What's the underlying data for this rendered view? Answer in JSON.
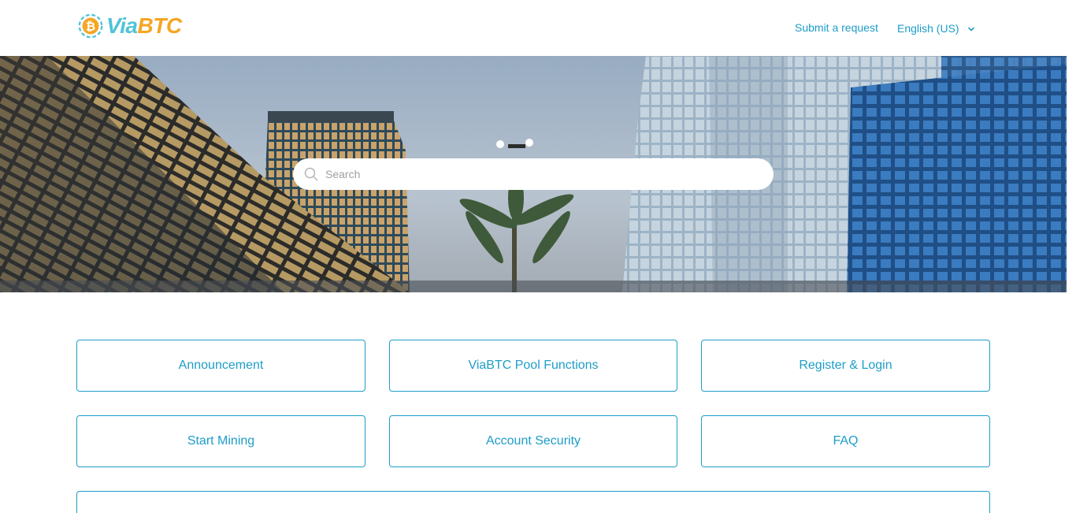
{
  "brand": {
    "name_part1": "Via",
    "name_part2": "BTC",
    "logo_icon": "bitcoin-coin-icon",
    "colors": {
      "via": "#4fc3d8",
      "btc": "#f5a623"
    }
  },
  "header": {
    "submit_request": "Submit a request",
    "language": "English (US)",
    "language_icon": "chevron-down-icon"
  },
  "search": {
    "placeholder": "Search",
    "icon": "search-icon"
  },
  "categories": [
    {
      "label": "Announcement"
    },
    {
      "label": "ViaBTC Pool Functions"
    },
    {
      "label": "Register & Login"
    },
    {
      "label": "Start Mining"
    },
    {
      "label": "Account Security"
    },
    {
      "label": "FAQ"
    },
    {
      "label": ""
    }
  ],
  "colors": {
    "accent": "#1e9dc8",
    "background": "#ffffff"
  }
}
